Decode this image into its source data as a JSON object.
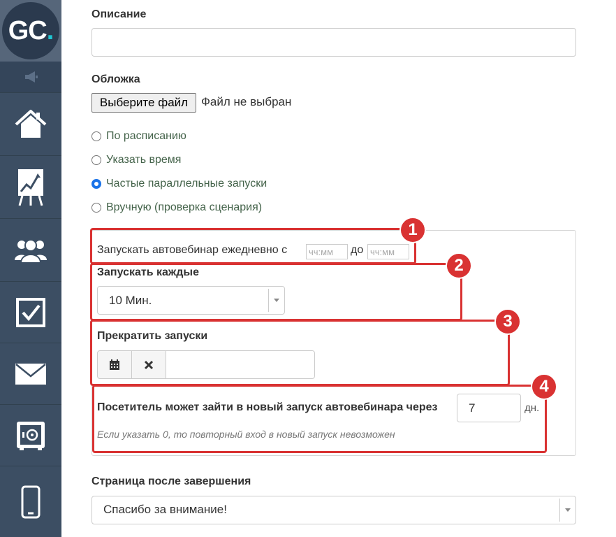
{
  "sidebar": {
    "logo": {
      "letters": "GC",
      "dot": "."
    },
    "items": [
      {
        "name": "home",
        "icon": "home-icon"
      },
      {
        "name": "statistics",
        "icon": "chart-board-icon"
      },
      {
        "name": "users",
        "icon": "users-icon"
      },
      {
        "name": "tasks",
        "icon": "checkbox-icon"
      },
      {
        "name": "messages",
        "icon": "envelope-icon"
      },
      {
        "name": "sales",
        "icon": "safe-icon"
      },
      {
        "name": "mobile",
        "icon": "phone-icon"
      }
    ],
    "colors": {
      "background": "#3c4e63",
      "logo_accent": "#1ec6d2"
    }
  },
  "form": {
    "description": {
      "label": "Описание",
      "value": ""
    },
    "cover": {
      "label": "Обложка",
      "button": "Выберите файл",
      "status": "Файл не выбран"
    },
    "launch_modes": [
      {
        "label": "По расписанию",
        "checked": false
      },
      {
        "label": "Указать время",
        "checked": false
      },
      {
        "label": "Частые параллельные запуски",
        "checked": true
      },
      {
        "label": "Вручную (проверка сценария)",
        "checked": false
      }
    ],
    "daily": {
      "text": "Запускать автовебинар ежедневно с",
      "from_placeholder": "чч:мм",
      "to_text": "до",
      "to_placeholder": "чч:мм"
    },
    "interval": {
      "label": "Запускать каждые",
      "value": "10 Мин."
    },
    "stop": {
      "label": "Прекратить запуски",
      "value": ""
    },
    "revisit": {
      "label": "Посетитель может зайти в новый запуск автовебинара через",
      "value": "7",
      "unit": "дн.",
      "hint": "Если указать 0, то повторный вход в новый запуск невозможен"
    },
    "after_page": {
      "label": "Страница после завершения",
      "value": "Спасибо за внимание!"
    }
  },
  "annotations": [
    "1",
    "2",
    "3",
    "4"
  ],
  "colors": {
    "annotation": "#d93232",
    "radio_label": "#44634a",
    "radio_checked": "#1a73e8"
  }
}
